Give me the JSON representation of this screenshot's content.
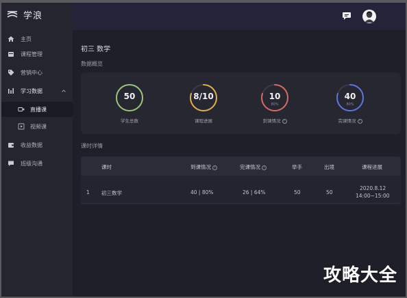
{
  "brand": {
    "name": "学浪"
  },
  "sidebar": {
    "items": [
      {
        "label": "主页",
        "icon": "home-icon"
      },
      {
        "label": "课程管理",
        "icon": "calendar-icon"
      },
      {
        "label": "营销中心",
        "icon": "tag-icon"
      },
      {
        "label": "学习数据",
        "icon": "bar-chart-icon",
        "expanded": true
      },
      {
        "label": "直播课",
        "icon": "video-camera-icon",
        "active": true
      },
      {
        "label": "视频课",
        "icon": "video-file-icon"
      },
      {
        "label": "收益数据",
        "icon": "wallet-icon"
      },
      {
        "label": "班级沟通",
        "icon": "chat-bubble-icon"
      }
    ]
  },
  "header": {
    "chat_icon": "chat-icon",
    "avatar": "avatar"
  },
  "main": {
    "title": "初三 数学",
    "overview_label": "数据概览",
    "stats": [
      {
        "value": "50",
        "sub": "",
        "label": "学生总数",
        "progress": 1.0,
        "color": "#9bc57b"
      },
      {
        "value": "8/10",
        "sub": "",
        "label": "课程进展",
        "progress": 0.8,
        "color": "#e3b04a"
      },
      {
        "value": "10",
        "sub": "80%",
        "label": "到课情况",
        "progress": 0.8,
        "color": "#d96a64"
      },
      {
        "value": "40",
        "sub": "80%",
        "label": "完课情况",
        "progress": 0.8,
        "color": "#5f74e0"
      }
    ],
    "detail_label": "课时详情",
    "table": {
      "headers": [
        "课时",
        "到课情况",
        "完课情况",
        "举手",
        "出境",
        "课程进展"
      ],
      "rows": [
        {
          "index": "1",
          "name": "初三数学",
          "attendance": "40 | 80%",
          "completion": "26 | 64%",
          "hands": "50",
          "appear": "50",
          "date": "2020.8.12",
          "time": "14:00~15:00"
        }
      ]
    }
  },
  "watermark": "攻略大全",
  "colors": {
    "sidebar": "#24252e",
    "header": "#23243a",
    "panel": "#262731"
  }
}
